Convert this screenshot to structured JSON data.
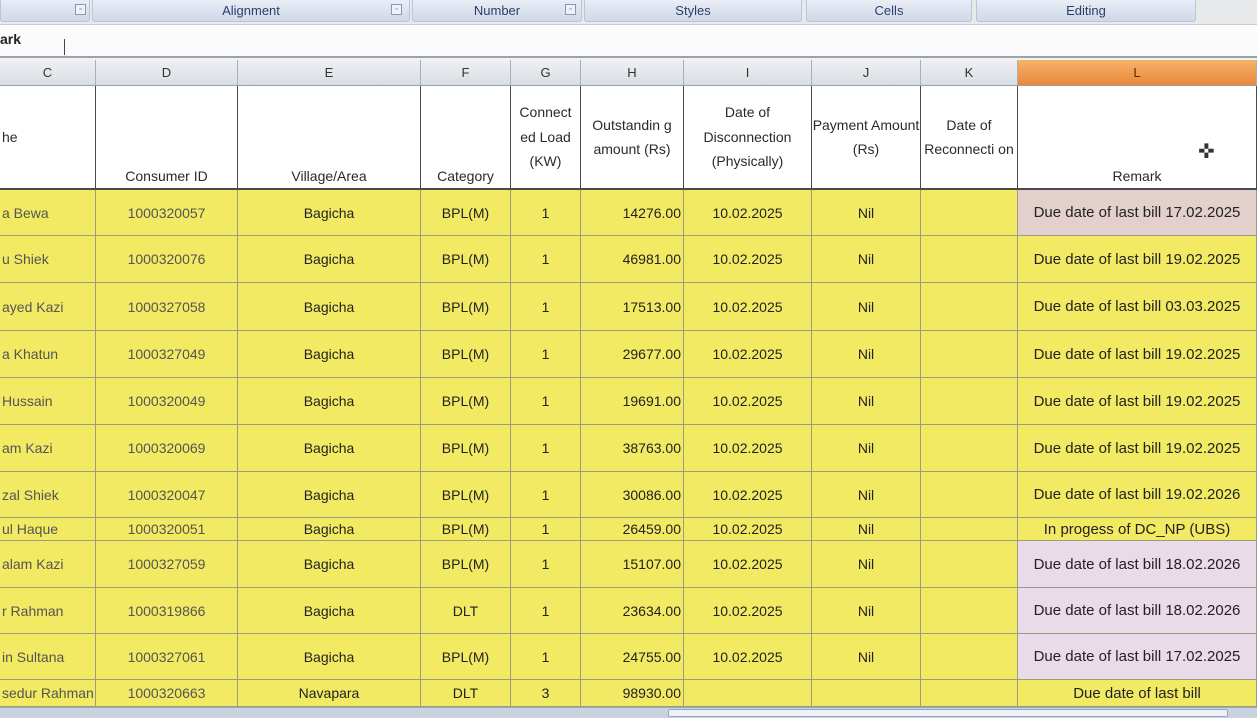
{
  "ribbon": {
    "groups": [
      {
        "label": "",
        "launcher": "▫"
      },
      {
        "label": "Alignment",
        "launcher": "▫"
      },
      {
        "label": "Number",
        "launcher": "▫"
      },
      {
        "label": "Styles"
      },
      {
        "label": "Cells"
      },
      {
        "label": "Editing"
      }
    ]
  },
  "formula_bar": {
    "text": "ark"
  },
  "columns": [
    "C",
    "D",
    "E",
    "F",
    "G",
    "H",
    "I",
    "J",
    "K",
    "L"
  ],
  "selected_column": "L",
  "headers": {
    "name": "he",
    "consumer_id": "Consumer ID",
    "village": "Village/Area",
    "category": "Category",
    "load": "Connect ed Load (KW)",
    "outstanding": "Outstandin g amount (Rs)",
    "disconnection": "Date of Disconnection (Physically)",
    "payment": "Payment Amount (Rs)",
    "reconnection": "Date of Reconnecti on",
    "remark": "Remark"
  },
  "rows": [
    {
      "name": "a Bewa",
      "id": "1000320057",
      "village": "Bagicha",
      "category": "BPL(M)",
      "load": "1",
      "amount": "14276.00",
      "date": "10.02.2025",
      "payment": "Nil",
      "reconnect": "",
      "remark": "Due date of last bill 17.02.2025"
    },
    {
      "name": "u Shiek",
      "id": "1000320076",
      "village": "Bagicha",
      "category": "BPL(M)",
      "load": "1",
      "amount": "46981.00",
      "date": "10.02.2025",
      "payment": "Nil",
      "reconnect": "",
      "remark": "Due date of last bill 19.02.2025"
    },
    {
      "name": "ayed Kazi",
      "id": "1000327058",
      "village": "Bagicha",
      "category": "BPL(M)",
      "load": "1",
      "amount": "17513.00",
      "date": "10.02.2025",
      "payment": "Nil",
      "reconnect": "",
      "remark": "Due date of last bill 03.03.2025"
    },
    {
      "name": "a Khatun",
      "id": "1000327049",
      "village": "Bagicha",
      "category": "BPL(M)",
      "load": "1",
      "amount": "29677.00",
      "date": "10.02.2025",
      "payment": "Nil",
      "reconnect": "",
      "remark": "Due date of last bill 19.02.2025"
    },
    {
      "name": "Hussain",
      "id": "1000320049",
      "village": "Bagicha",
      "category": "BPL(M)",
      "load": "1",
      "amount": "19691.00",
      "date": "10.02.2025",
      "payment": "Nil",
      "reconnect": "",
      "remark": "Due date of last bill 19.02.2025"
    },
    {
      "name": "am Kazi",
      "id": "1000320069",
      "village": "Bagicha",
      "category": "BPL(M)",
      "load": "1",
      "amount": "38763.00",
      "date": "10.02.2025",
      "payment": "Nil",
      "reconnect": "",
      "remark": "Due date of last bill 19.02.2025"
    },
    {
      "name": "zal Shiek",
      "id": "1000320047",
      "village": "Bagicha",
      "category": "BPL(M)",
      "load": "1",
      "amount": "30086.00",
      "date": "10.02.2025",
      "payment": "Nil",
      "reconnect": "",
      "remark": "Due date of last bill 19.02.2026"
    },
    {
      "name": "ul Haque",
      "id": "1000320051",
      "village": "Bagicha",
      "category": "BPL(M)",
      "load": "1",
      "amount": "26459.00",
      "date": "10.02.2025",
      "payment": "Nil",
      "reconnect": "",
      "remark": "In progess of DC_NP (UBS)"
    },
    {
      "name": "alam Kazi",
      "id": "1000327059",
      "village": "Bagicha",
      "category": "BPL(M)",
      "load": "1",
      "amount": "15107.00",
      "date": "10.02.2025",
      "payment": "Nil",
      "reconnect": "",
      "remark": "Due date of last bill 18.02.2026"
    },
    {
      "name": "r Rahman",
      "id": "1000319866",
      "village": "Bagicha",
      "category": "DLT",
      "load": "1",
      "amount": "23634.00",
      "date": "10.02.2025",
      "payment": "Nil",
      "reconnect": "",
      "remark": "Due date of last bill 18.02.2026"
    },
    {
      "name": "in Sultana",
      "id": "1000327061",
      "village": "Bagicha",
      "category": "BPL(M)",
      "load": "1",
      "amount": "24755.00",
      "date": "10.02.2025",
      "payment": "Nil",
      "reconnect": "",
      "remark": "Due date of last bill 17.02.2025"
    },
    {
      "name": "sedur Rahman",
      "id": "1000320663",
      "village": "Navapara",
      "category": "DLT",
      "load": "3",
      "amount": "98930.00",
      "date": "",
      "payment": "",
      "reconnect": "",
      "remark": "Due date of last bill"
    }
  ],
  "remark_fill": [
    "pink",
    "yellow",
    "yellow",
    "yellow",
    "yellow",
    "yellow",
    "yellow",
    "yellow",
    "lavender",
    "lavender",
    "lavender",
    "yellow"
  ],
  "colors": {
    "cell_yellow": "#f2ea62",
    "remark_pink": "#e3d0cc",
    "remark_lavender": "#eadbe8",
    "selected_header": "#e8883a"
  }
}
